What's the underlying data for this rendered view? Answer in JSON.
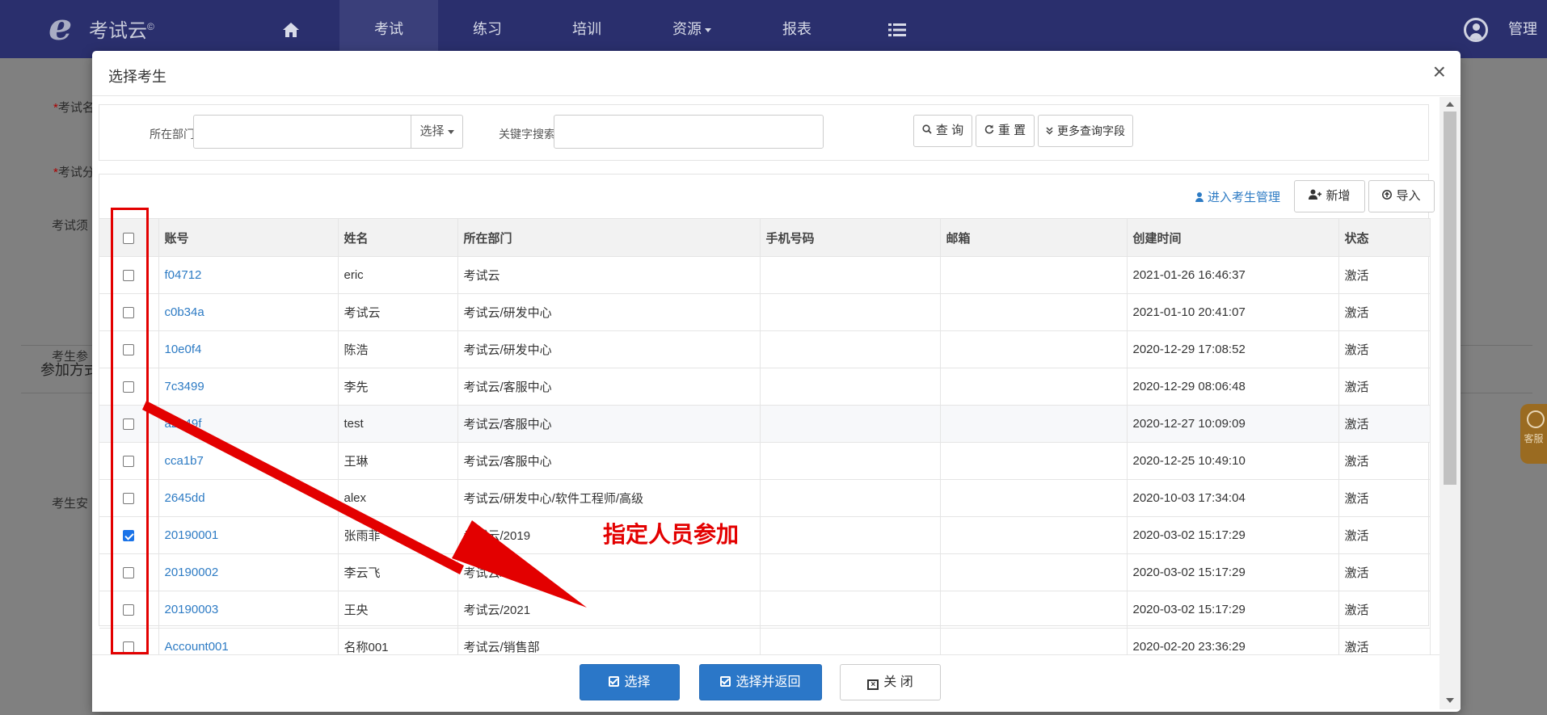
{
  "nav": {
    "logo_text": "考试云",
    "logo_mark": "e",
    "items": [
      "考试",
      "练习",
      "培训",
      "资源",
      "报表"
    ],
    "admin_label": "管理"
  },
  "background": {
    "labels": [
      "考试名",
      "考试分",
      "考试须",
      "考生参",
      "考生安"
    ],
    "section_title": "参加方式",
    "kefu_label": "客服"
  },
  "modal": {
    "title": "选择考生",
    "close_symbol": "×"
  },
  "search": {
    "dept_label": "所在部门",
    "dept_value": "",
    "select_label": "选择",
    "keyword_label": "关键字搜索",
    "keyword_value": "",
    "query_label": "查 询",
    "reset_label": "重 置",
    "more_label": "更多查询字段"
  },
  "toolbar": {
    "manage_link": "进入考生管理",
    "add_label": "新增",
    "import_label": "导入"
  },
  "table": {
    "columns": [
      "账号",
      "姓名",
      "所在部门",
      "手机号码",
      "邮箱",
      "创建时间",
      "状态"
    ],
    "rows": [
      {
        "account": "f04712",
        "name": "eric",
        "dept": "考试云",
        "phone": "",
        "email": "",
        "created": "2021-01-26 16:46:37",
        "status": "激活",
        "checked": false
      },
      {
        "account": "c0b34a",
        "name": "考试云",
        "dept": "考试云/研发中心",
        "phone": "",
        "email": "",
        "created": "2021-01-10 20:41:07",
        "status": "激活",
        "checked": false
      },
      {
        "account": "10e0f4",
        "name": "陈浩",
        "dept": "考试云/研发中心",
        "phone": "",
        "email": "",
        "created": "2020-12-29 17:08:52",
        "status": "激活",
        "checked": false
      },
      {
        "account": "7c3499",
        "name": "李先",
        "dept": "考试云/客服中心",
        "phone": "",
        "email": "",
        "created": "2020-12-29 08:06:48",
        "status": "激活",
        "checked": false
      },
      {
        "account": "a2349f",
        "name": "test",
        "dept": "考试云/客服中心",
        "phone": "",
        "email": "",
        "created": "2020-12-27 10:09:09",
        "status": "激活",
        "checked": false
      },
      {
        "account": "cca1b7",
        "name": "王琳",
        "dept": "考试云/客服中心",
        "phone": "",
        "email": "",
        "created": "2020-12-25 10:49:10",
        "status": "激活",
        "checked": false
      },
      {
        "account": "2645dd",
        "name": "alex",
        "dept": "考试云/研发中心/软件工程师/高级",
        "phone": "",
        "email": "",
        "created": "2020-10-03 17:34:04",
        "status": "激活",
        "checked": false
      },
      {
        "account": "20190001",
        "name": "张雨菲",
        "dept": "考试云/2019",
        "phone": "",
        "email": "",
        "created": "2020-03-02 15:17:29",
        "status": "激活",
        "checked": true
      },
      {
        "account": "20190002",
        "name": "李云飞",
        "dept": "考试云/2020",
        "phone": "",
        "email": "",
        "created": "2020-03-02 15:17:29",
        "status": "激活",
        "checked": false
      },
      {
        "account": "20190003",
        "name": "王央",
        "dept": "考试云/2021",
        "phone": "",
        "email": "",
        "created": "2020-03-02 15:17:29",
        "status": "激活",
        "checked": false
      },
      {
        "account": "Account001",
        "name": "名称001",
        "dept": "考试云/销售部",
        "phone": "",
        "email": "",
        "created": "2020-02-20 23:36:29",
        "status": "激活",
        "checked": false
      }
    ]
  },
  "footer": {
    "select_label": "选择",
    "select_return_label": "选择并返回",
    "close_label": "关 闭"
  },
  "annotation": {
    "text": "指定人员参加",
    "color": "#e30000"
  },
  "colors": {
    "nav_bg": "#2a2f6d",
    "link": "#2d7bc4",
    "primary": "#2b77c8"
  }
}
